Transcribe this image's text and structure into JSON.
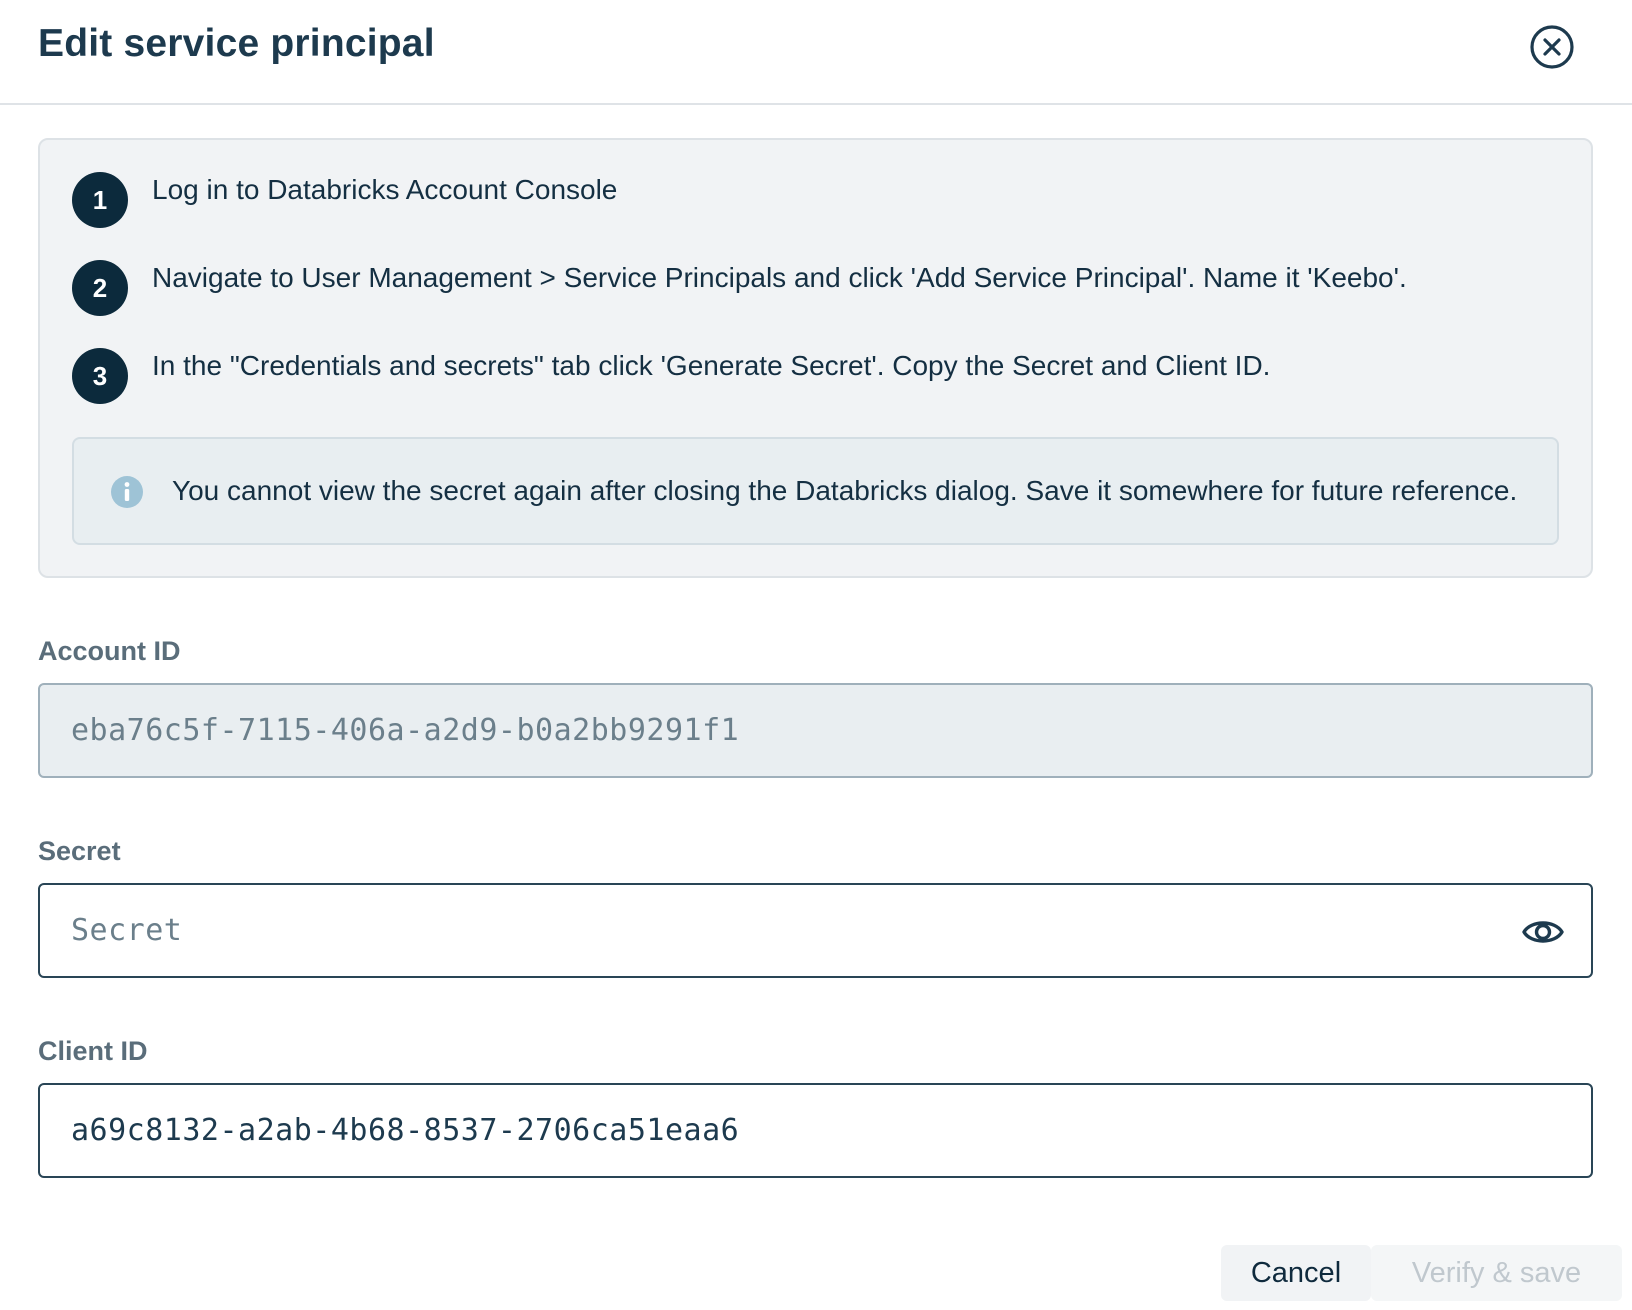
{
  "dialog": {
    "title": "Edit service principal"
  },
  "steps": [
    {
      "number": "1",
      "text": "Log in to Databricks Account Console"
    },
    {
      "number": "2",
      "text": "Navigate to User Management > Service Principals and click 'Add Service Principal'. Name it 'Keebo'."
    },
    {
      "number": "3",
      "text": "In the \"Credentials and secrets\" tab click 'Generate Secret'. Copy the Secret and Client ID."
    }
  ],
  "info": {
    "text": "You cannot view the secret again after closing the Databricks dialog. Save it somewhere for future reference."
  },
  "fields": {
    "account_id": {
      "label": "Account ID",
      "value": "eba76c5f-7115-406a-a2d9-b0a2bb9291f1"
    },
    "secret": {
      "label": "Secret",
      "placeholder": "Secret",
      "value": ""
    },
    "client_id": {
      "label": "Client ID",
      "value": "a69c8132-a2ab-4b68-8537-2706ca51eaa6"
    }
  },
  "footer": {
    "cancel_label": "Cancel",
    "save_label": "Verify & save"
  },
  "icons": {
    "close": "close-circle-icon",
    "info": "info-icon",
    "eye": "eye-icon"
  },
  "colors": {
    "primary_dark": "#0c2a3c",
    "info_icon": "#9ec3d6",
    "panel_bg": "#f1f3f5"
  }
}
